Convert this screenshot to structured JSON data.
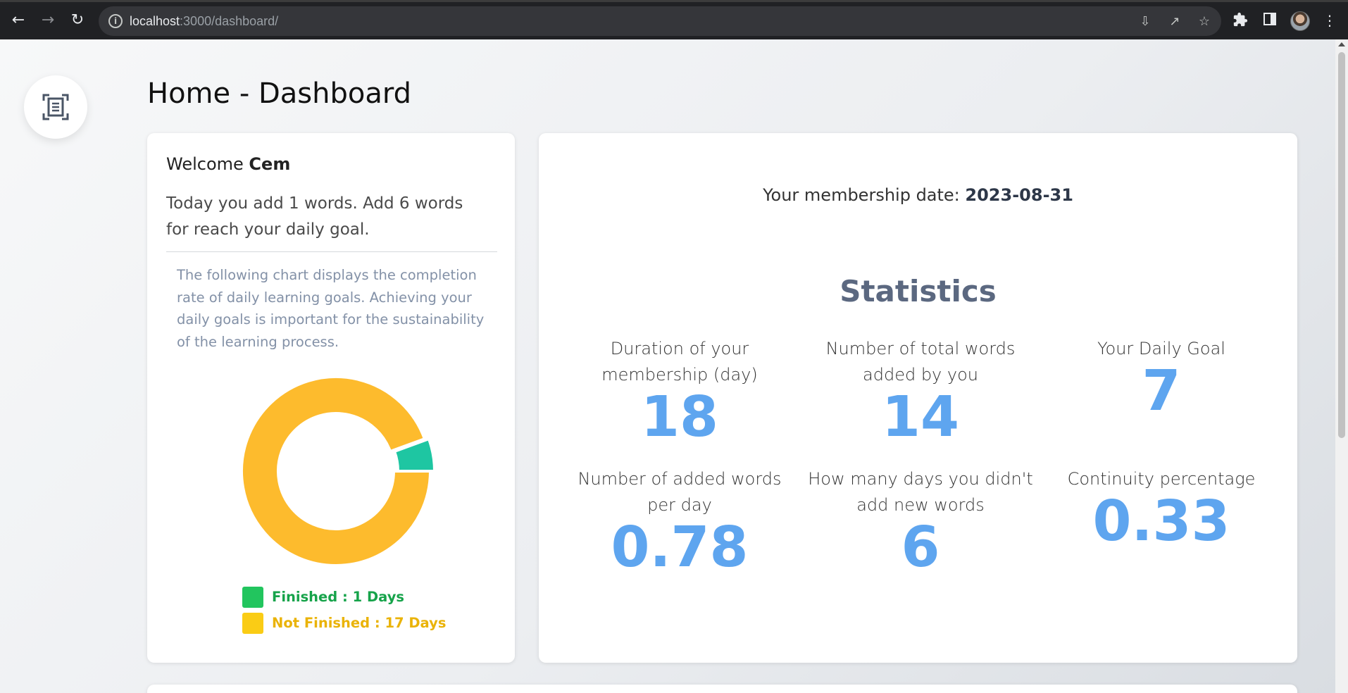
{
  "browser": {
    "url_host": "localhost",
    "url_path": ":3000/dashboard/",
    "icons": [
      "back-arrow-icon",
      "forward-arrow-icon",
      "reload-icon",
      "info-icon",
      "install-icon",
      "share-icon",
      "star-icon",
      "extensions-icon",
      "side-panel-icon",
      "profile-avatar",
      "menu-icon"
    ]
  },
  "page": {
    "title": "Home - Dashboard"
  },
  "welcome": {
    "greeting": "Welcome",
    "user": "Cem",
    "today_text": "Today you add 1 words. Add 6 words for reach your daily goal.",
    "chart_description": "The following chart displays the completion rate of daily learning goals. Achieving your daily goals is important for the sustainability of the learning process."
  },
  "chart_data": {
    "type": "pie",
    "variant": "doughnut",
    "slices": [
      {
        "label": "Finished",
        "value": 1,
        "color": "#1ec6a2"
      },
      {
        "label": "Not Finished",
        "value": 17,
        "color": "#fdbb2d"
      }
    ],
    "legend": [
      {
        "text": "Finished : 1 Days",
        "swatch": "#22c55e",
        "text_color": "#16a34a"
      },
      {
        "text": "Not Finished : 17 Days",
        "swatch": "#facc15",
        "text_color": "#eab308"
      }
    ]
  },
  "membership": {
    "label": "Your membership date:",
    "date": "2023-08-31"
  },
  "statistics": {
    "title": "Statistics",
    "items": [
      {
        "label": "Duration of your membership (day)",
        "value": "18"
      },
      {
        "label": "Number of total words added by you",
        "value": "14"
      },
      {
        "label": "Your Daily Goal",
        "value": "7"
      },
      {
        "label": "Number of added words per day",
        "value": "0.78"
      },
      {
        "label": "How many days you didn't add new words",
        "value": "6"
      },
      {
        "label": "Continuity percentage",
        "value": "0.33"
      }
    ]
  },
  "colors": {
    "stat_value": "#5ea5ef",
    "stats_title": "#5b6880",
    "finished": "#1ec6a2",
    "not_finished": "#fdbb2d"
  }
}
